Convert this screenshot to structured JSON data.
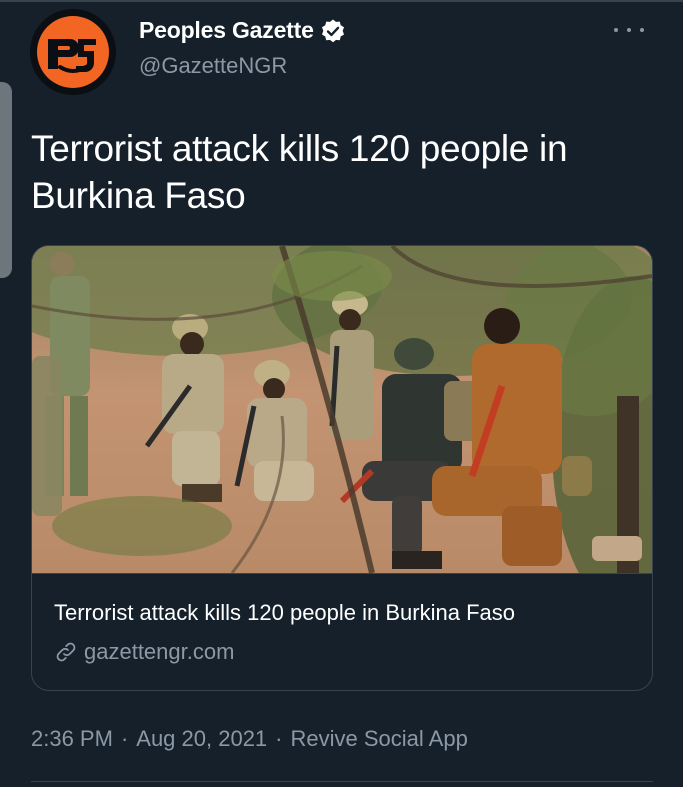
{
  "author": {
    "display_name": "Peoples Gazette",
    "handle": "@GazetteNGR",
    "avatar_logo_text": "pg",
    "avatar_icon": "pg-logo",
    "verified_icon": "verified-badge-icon"
  },
  "tweet": {
    "text": "Terrorist attack kills 120 people in Burkina Faso",
    "more_icon": "more-options-icon"
  },
  "link_card": {
    "title": "Terrorist attack kills 120 people in Burkina Faso",
    "domain": "gazettengr.com",
    "link_icon": "link-icon",
    "image_alt": "soldiers-kneeling-in-brush"
  },
  "meta": {
    "time": "2:36 PM",
    "separator": "·",
    "date": "Aug 20, 2021",
    "source": "Revive Social App"
  },
  "colors": {
    "background": "#15202b",
    "primary_text": "#ffffff",
    "secondary_text": "#8b98a5",
    "border": "#38444d",
    "logo_orange": "#f26522"
  }
}
